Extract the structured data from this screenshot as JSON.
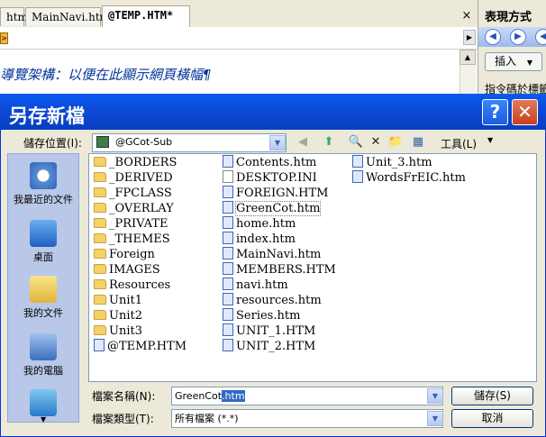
{
  "editor": {
    "tabs": [
      {
        "label": "htm"
      },
      {
        "label": "MainNavi.htm"
      },
      {
        "label": "@TEMP.HTM*"
      }
    ],
    "close_glyph": "×",
    "content_text": "導覽架構：以便在此顯示網頁橫幅¶"
  },
  "side_panel": {
    "title": "表現方式",
    "insert_label": "插入",
    "hint": "指令碼於標籤"
  },
  "dialog": {
    "title": "另存新檔",
    "help_glyph": "?",
    "close_glyph": "✕",
    "save_in_label": "儲存位置(I):",
    "save_in_value": "@GCot-Sub",
    "tools_label": "工具(L)",
    "places": [
      {
        "label": "我最近的文件",
        "icon": "recent-documents-icon"
      },
      {
        "label": "桌面",
        "icon": "desktop-icon"
      },
      {
        "label": "我的文件",
        "icon": "my-documents-icon"
      },
      {
        "label": "我的電腦",
        "icon": "my-computer-icon"
      },
      {
        "label": "",
        "icon": "network-places-icon"
      }
    ],
    "files_col1": [
      "_BORDERS",
      "_DERIVED",
      "_FPCLASS",
      "_OVERLAY",
      "_PRIVATE",
      "_THEMES",
      "Foreign",
      "IMAGES",
      "Resources",
      "Unit1",
      "Unit2",
      "Unit3",
      "@TEMP.HTM"
    ],
    "files_col2": [
      "Contents.htm",
      "DESKTOP.INI",
      "FOREIGN.HTM",
      "GreenCot.htm",
      "home.htm",
      "index.htm",
      "MainNavi.htm",
      "MEMBERS.HTM",
      "navi.htm",
      "resources.htm",
      "Series.htm",
      "UNIT_1.HTM",
      "UNIT_2.HTM"
    ],
    "files_col3": [
      "Unit_3.htm",
      "WordsFrEIC.htm"
    ],
    "filename_label": "檔案名稱(N):",
    "filename_value_prefix": "GreenCot",
    "filename_value_selected": ".htm",
    "filetype_label": "檔案類型(T):",
    "filetype_value": "所有檔案 (*.*)",
    "save_button": "儲存(S)",
    "cancel_button": "取消"
  },
  "colors": {
    "title_bar": "#0b49d4",
    "selection": "#316ac5",
    "folder": "#f4d266"
  }
}
